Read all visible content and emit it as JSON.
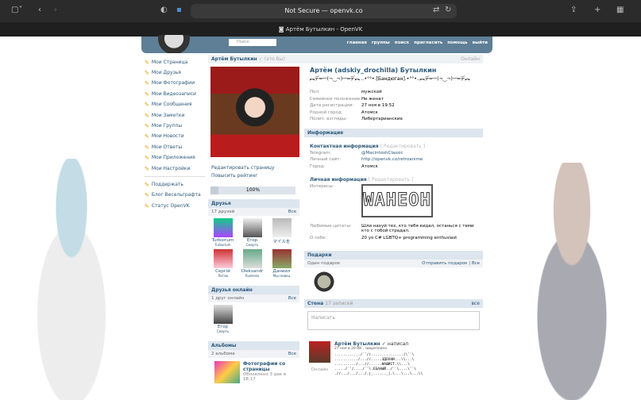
{
  "browser": {
    "url": "Not Secure — openvk.co",
    "tab_title": "Артём Бутылкин - OpenVK"
  },
  "header": {
    "search_placeholder": "Поиск",
    "nav": [
      "главная",
      "группы",
      "поиск",
      "пригласить",
      "помощь",
      "выйти"
    ]
  },
  "menu": {
    "items": [
      "Мои Страница",
      "Мои Друзья",
      "Мои Фотографии",
      "Мои Видеозаписи",
      "Мои Сообщения",
      "Мои Заметки",
      "Мои Группы",
      "Мои Новости",
      "Мои Ответы",
      "Мои Приложения",
      "Мои Настройки"
    ],
    "extra": [
      "Поддержать",
      "Блог Весельграфта",
      "Статус OpenVK"
    ]
  },
  "profile": {
    "header_name": "Артём Бутылкин",
    "you": "(это Вы)",
    "online": "Онлайн",
    "full_name": "Артём (adskiy_drochilla) Бутылкин",
    "status": "︻デ═一(¬‿¬)一═デ︻ ..•°°•.[Бандюган].•°°•..︻デ═一(¬‿¬)一═デ︻",
    "fields": [
      {
        "k": "Пол:",
        "v": "мужской"
      },
      {
        "k": "Семейное положение:",
        "v": "Не женат"
      },
      {
        "k": "Дата регистрации:",
        "v": "27 ноя в 19:52"
      },
      {
        "k": "Родной город:",
        "v": "Атомск"
      },
      {
        "k": "Полит. взгляды:",
        "v": "Либертарианские"
      }
    ],
    "edit_page": "Редактировать страницу",
    "raise_rating": "Повысить рейтинг",
    "rating": "100%"
  },
  "info": {
    "title": "Информация",
    "contact_title": "Контактная информация",
    "edit": "[ Редактировать ]",
    "contact": [
      {
        "k": "Telegram:",
        "v": "@MacintoshClassic"
      },
      {
        "k": "Личный сайт:",
        "v": "http://openvk.co/retroanime"
      },
      {
        "k": "Город:",
        "v": "Атомск"
      }
    ],
    "personal_title": "Личная информация",
    "interests_label": "Интересы:",
    "interests_art": "WAHEOH",
    "quotes_label": "Любимые цитаты:",
    "quotes": "Шли нахуй тех, кто тебя кидал, останься с теми кто с тобой страдал.",
    "about_label": "О себе:",
    "about": "20 yo C# LGBTQ+ programming enthusiast"
  },
  "friends": {
    "title": "Друзья",
    "count": "17 друзей",
    "all": "Все",
    "items": [
      {
        "n": "Turborium",
        "l": "Turborium"
      },
      {
        "n": "Егор",
        "l": "Смерть"
      },
      {
        "n": "マイルを",
        "l": ""
      },
      {
        "n": "Сергій",
        "l": "Литов"
      },
      {
        "n": "Oleksandr",
        "l": "Rudenko"
      },
      {
        "n": "Даниил",
        "l": "Мысливец"
      }
    ]
  },
  "online_friends": {
    "title": "Друзья онлайн",
    "count": "1 друг онлайн",
    "all": "Все",
    "items": [
      {
        "n": "Егор",
        "l": "Смерть"
      }
    ]
  },
  "albums": {
    "title": "Альбомы",
    "count": "2 альбома",
    "all": "Все",
    "item": {
      "t": "Фотографии со страницы",
      "d": "Обновлено 3 дек в 18:17"
    }
  },
  "gifts": {
    "title": "Подарки",
    "count": "Один подарок",
    "send": "Отправить подарок",
    "all": "Все"
  },
  "wall": {
    "title": "Стена",
    "count": "17 записей",
    "all": "все",
    "placeholder": "Написать",
    "post": {
      "author": "Артём Бутылкин",
      "action": "написал",
      "date": "27 ноя в 20:08 , закреплено",
      "online": "Онлайн",
      "text": "............/´¯/)...............(\\¯`\\\n.........../...//.....ЗДОХНИ...\\\\...\\\n........../...//......ФАШИСТ.\\\\...\\\n...../´¯/..../´¯\\.ЕБАНЫЙ../¯`\\....\\¯`\\\n.//.../.../.../.|_......_|.\\...\\...\\...\\\\"
    }
  },
  "colors": {
    "link": "#2b587a",
    "header": "#5f7f96",
    "section": "#dde5ee"
  }
}
